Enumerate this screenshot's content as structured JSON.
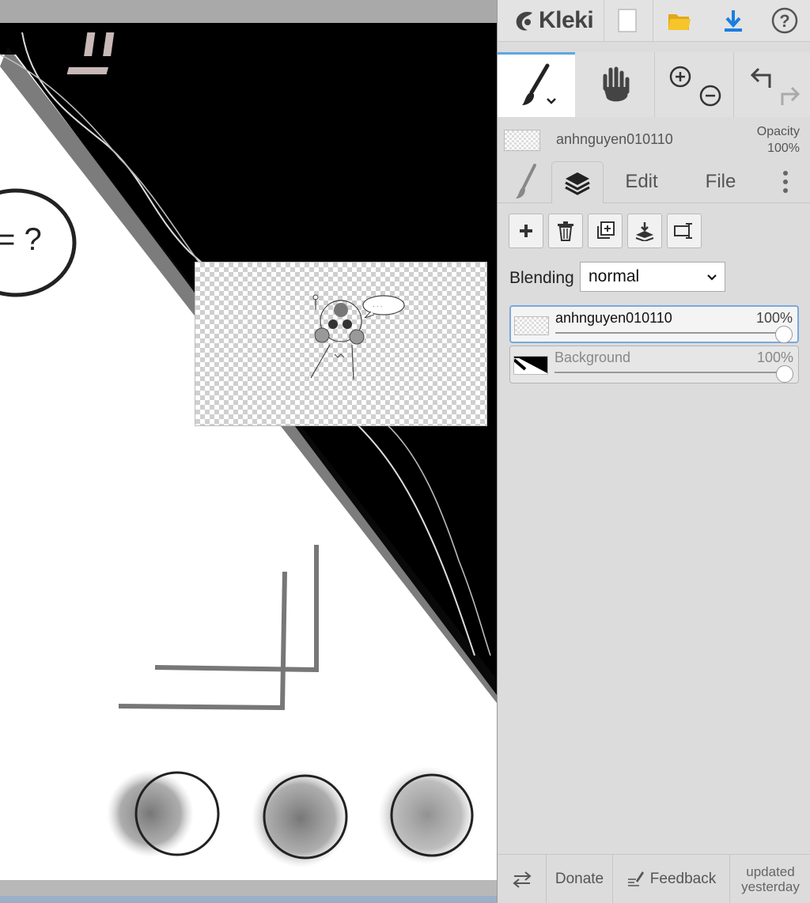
{
  "app": {
    "name": "Kleki"
  },
  "topbar": {
    "new_icon": "new-document-icon",
    "open_icon": "folder-open-icon",
    "save_icon": "download-icon",
    "help_icon": "help-icon"
  },
  "tools": [
    "brush-tool",
    "hand-tool",
    "zoom-tool",
    "undo-redo"
  ],
  "active_layer": {
    "name": "anhnguyen010110",
    "opacity_label": "Opacity",
    "opacity_value": "100%"
  },
  "tabs": {
    "brush": "brush-icon",
    "layers": "layers-icon",
    "edit": "Edit",
    "file": "File"
  },
  "layer_actions": [
    "add-layer",
    "delete-layer",
    "duplicate-layer",
    "merge-down",
    "rename-layer"
  ],
  "blending": {
    "label": "Blending",
    "value": "normal"
  },
  "layers": [
    {
      "name": "anhnguyen010110",
      "opacity": "100%",
      "opacity_fraction": 1.0,
      "selected": true
    },
    {
      "name": "Background",
      "opacity": "100%",
      "opacity_fraction": 1.0,
      "selected": false
    }
  ],
  "canvas": {
    "bubble_text": "= ?"
  },
  "footer": {
    "swap_icon": "swap-icon",
    "donate": "Donate",
    "feedback": "Feedback",
    "updated_line1": "updated",
    "updated_line2": "yesterday"
  },
  "colors": {
    "accent": "#5fa7e0",
    "panel_bg": "#dcdcdc",
    "download_blue": "#1a7fe0",
    "folder_yellow": "#f4c020"
  }
}
